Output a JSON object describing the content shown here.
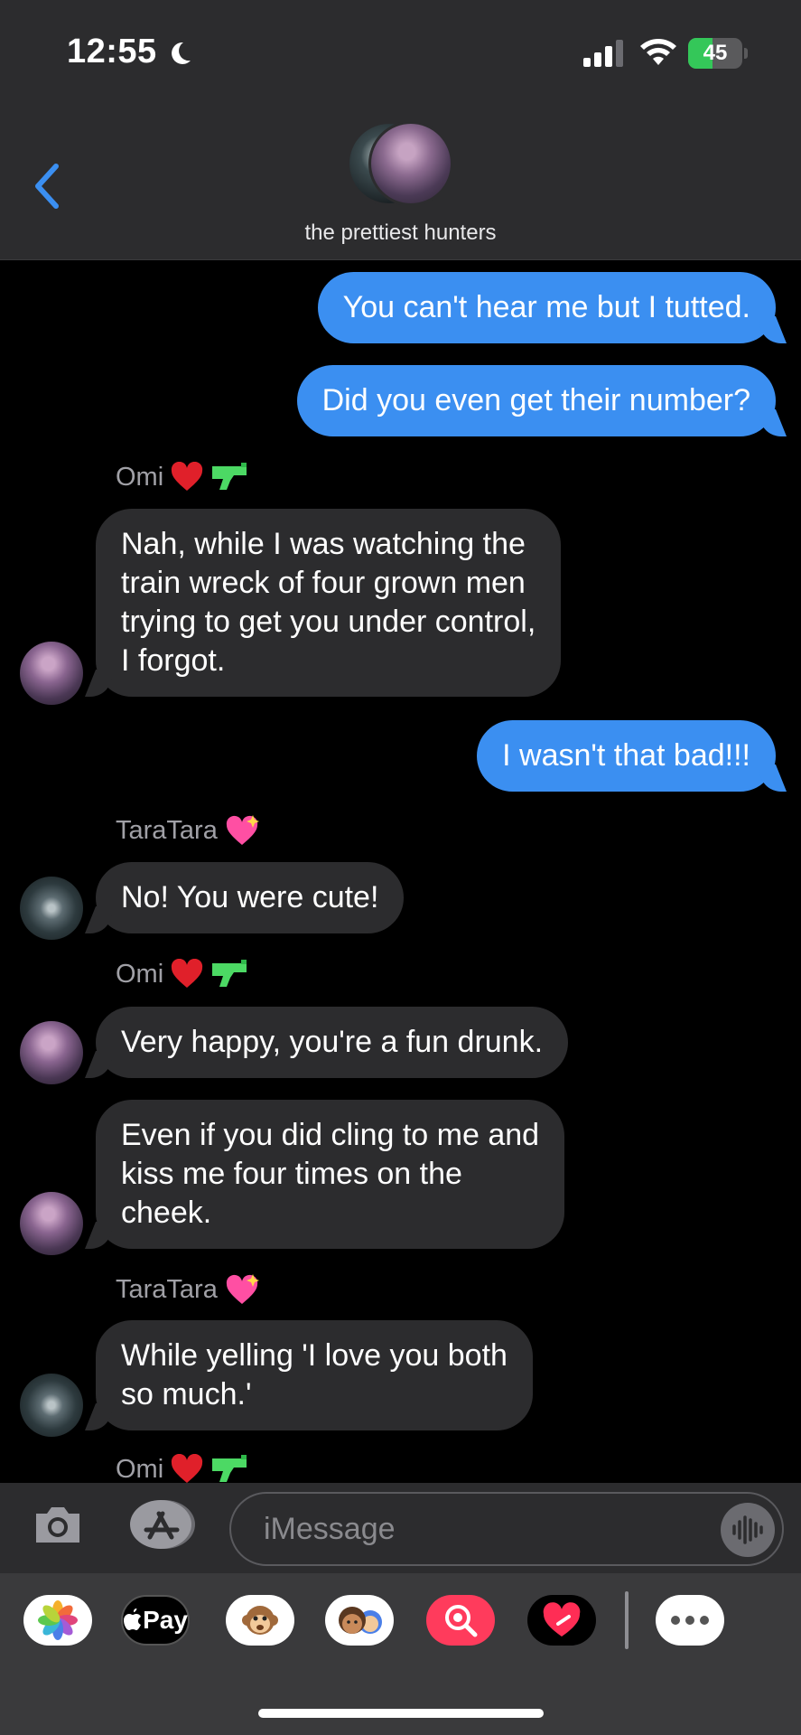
{
  "status_bar": {
    "time": "12:55",
    "focus_icon": "moon-icon",
    "battery_percent": 45,
    "battery_label": "45",
    "colors": {
      "battery_fill": "#34c759"
    }
  },
  "header": {
    "back_icon": "chevron-left-icon",
    "group_name": "the prettiest hunters"
  },
  "messages": [
    {
      "direction": "outgoing",
      "text": "You can't hear me but I tutted."
    },
    {
      "direction": "outgoing",
      "text": "Did you even get their number?"
    },
    {
      "sender": "Omi",
      "sender_emoji": [
        "red-heart-emoji",
        "water-pistol-emoji"
      ]
    },
    {
      "direction": "incoming",
      "from": "Omi",
      "text": "Nah, while I was watching the\ntrain wreck of four grown men\ntrying to get you under control,\nI forgot."
    },
    {
      "direction": "outgoing",
      "text": "I wasn't that bad!!!"
    },
    {
      "sender": "TaraTara",
      "sender_emoji": [
        "sparkling-heart-emoji"
      ]
    },
    {
      "direction": "incoming",
      "from": "TaraTara",
      "text": "No! You were cute!"
    },
    {
      "sender": "Omi",
      "sender_emoji": [
        "red-heart-emoji",
        "water-pistol-emoji"
      ]
    },
    {
      "direction": "incoming",
      "from": "Omi",
      "text": "Very happy, you're a fun drunk."
    },
    {
      "direction": "incoming",
      "from": "Omi",
      "text": "Even if you did cling to me and\nkiss me four times on the\ncheek."
    },
    {
      "sender": "TaraTara",
      "sender_emoji": [
        "sparkling-heart-emoji"
      ]
    },
    {
      "direction": "incoming",
      "from": "TaraTara",
      "text": "While yelling 'I love you both\nso much.'"
    },
    {
      "sender": "Omi",
      "sender_emoji": [
        "red-heart-emoji",
        "water-pistol-emoji"
      ]
    }
  ],
  "composer": {
    "placeholder": "iMessage",
    "camera_icon": "camera-icon",
    "apps_icon": "app-store-icon",
    "audio_icon": "waveform-icon"
  },
  "app_drawer": {
    "apps": [
      "photos-app",
      "apple-pay-app",
      "memoji-stickers-app",
      "memoji-app",
      "image-search-app",
      "digital-touch-app",
      "more-apps"
    ],
    "apple_pay_label": "Pay"
  }
}
